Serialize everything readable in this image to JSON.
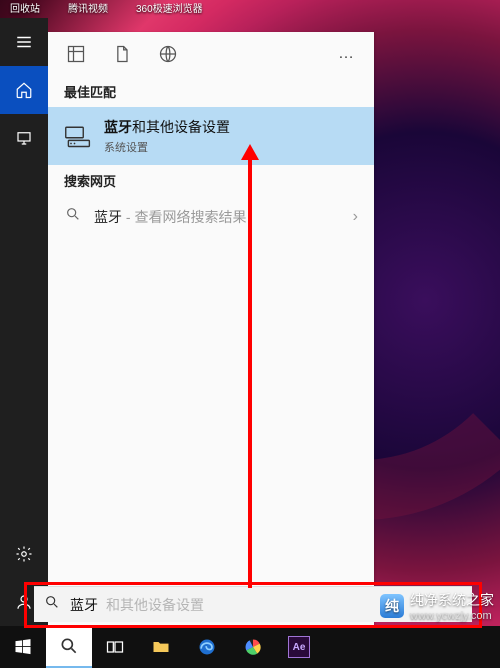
{
  "desktop": {
    "icons": [
      {
        "label": "回收站"
      },
      {
        "label": "腾讯视频"
      },
      {
        "label": "360极速浏览器"
      }
    ]
  },
  "left_rail": {
    "items": [
      {
        "name": "hamburger"
      },
      {
        "name": "home",
        "active": true
      },
      {
        "name": "monitor"
      }
    ],
    "bottom": [
      {
        "name": "settings"
      },
      {
        "name": "account"
      }
    ]
  },
  "panel": {
    "top_tabs": [
      {
        "name": "apps"
      },
      {
        "name": "documents"
      },
      {
        "name": "web"
      }
    ],
    "more_label": "…",
    "best_match_header": "最佳匹配",
    "best_match": {
      "title_hl": "蓝牙",
      "title_rest": "和其他设备设置",
      "subtitle": "系统设置"
    },
    "web_header": "搜索网页",
    "web_item": {
      "query": "蓝牙",
      "hint": " - 查看网络搜索结果"
    }
  },
  "search": {
    "typed": "蓝牙",
    "suggestion": "和其他设备设置"
  },
  "taskbar": {
    "items": [
      {
        "name": "start"
      },
      {
        "name": "search",
        "active": true
      },
      {
        "name": "taskview"
      },
      {
        "name": "file-explorer"
      },
      {
        "name": "edge"
      },
      {
        "name": "browser-colorful"
      },
      {
        "name": "adobe-after-effects",
        "label": "Ae"
      }
    ]
  },
  "watermark": {
    "text": "纯净系统之家",
    "url": "www.ycwzjy.com"
  }
}
